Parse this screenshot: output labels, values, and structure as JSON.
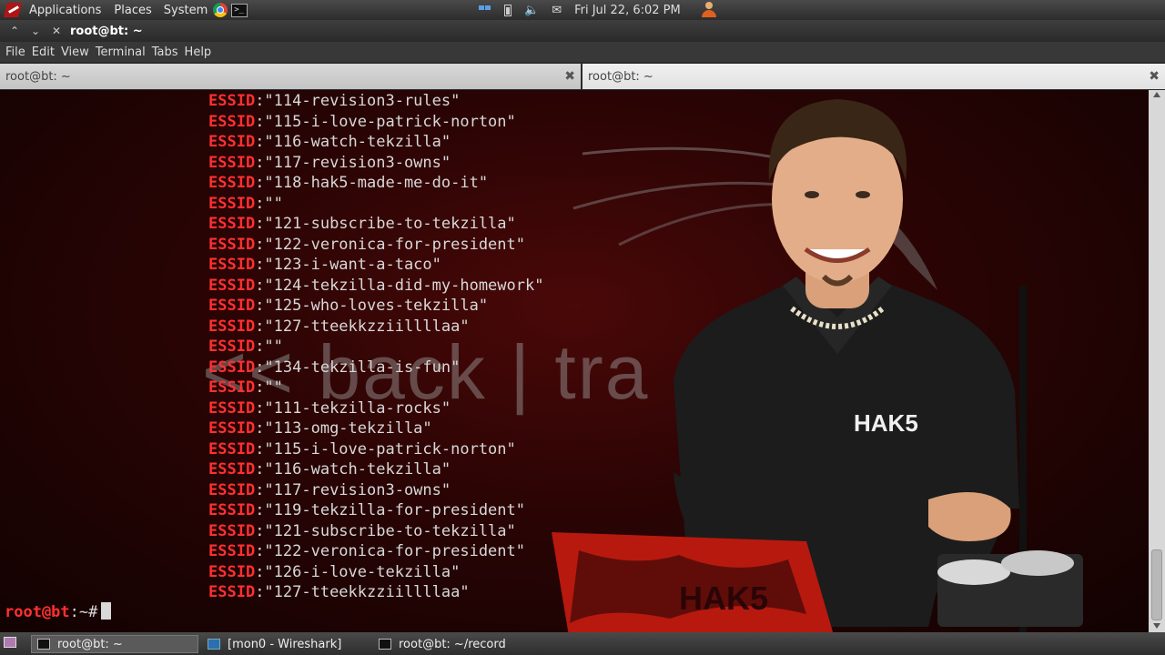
{
  "top_panel": {
    "menus": [
      "Applications",
      "Places",
      "System"
    ],
    "clock": "Fri Jul 22,  6:02 PM"
  },
  "window": {
    "title": "root@bt: ~",
    "menu": [
      "File",
      "Edit",
      "View",
      "Terminal",
      "Tabs",
      "Help"
    ],
    "tabs": [
      {
        "label": "root@bt: ~",
        "active": false
      },
      {
        "label": "root@bt: ~",
        "active": true
      }
    ]
  },
  "terminal": {
    "lines": [
      {
        "key": "ESSID",
        "value": ":\"114-revision3-rules\""
      },
      {
        "key": "ESSID",
        "value": ":\"115-i-love-patrick-norton\""
      },
      {
        "key": "ESSID",
        "value": ":\"116-watch-tekzilla\""
      },
      {
        "key": "ESSID",
        "value": ":\"117-revision3-owns\""
      },
      {
        "key": "ESSID",
        "value": ":\"118-hak5-made-me-do-it\""
      },
      {
        "key": "ESSID",
        "value": ":\"\""
      },
      {
        "key": "ESSID",
        "value": ":\"121-subscribe-to-tekzilla\""
      },
      {
        "key": "ESSID",
        "value": ":\"122-veronica-for-president\""
      },
      {
        "key": "ESSID",
        "value": ":\"123-i-want-a-taco\""
      },
      {
        "key": "ESSID",
        "value": ":\"124-tekzilla-did-my-homework\""
      },
      {
        "key": "ESSID",
        "value": ":\"125-who-loves-tekzilla\""
      },
      {
        "key": "ESSID",
        "value": ":\"127-tteekkzziillllaa\""
      },
      {
        "key": "ESSID",
        "value": ":\"\""
      },
      {
        "key": "ESSID",
        "value": ":\"134-tekzilla-is-fun\""
      },
      {
        "key": "ESSID",
        "value": ":\"\""
      },
      {
        "key": "ESSID",
        "value": ":\"111-tekzilla-rocks\""
      },
      {
        "key": "ESSID",
        "value": ":\"113-omg-tekzilla\""
      },
      {
        "key": "ESSID",
        "value": ":\"115-i-love-patrick-norton\""
      },
      {
        "key": "ESSID",
        "value": ":\"116-watch-tekzilla\""
      },
      {
        "key": "ESSID",
        "value": ":\"117-revision3-owns\""
      },
      {
        "key": "ESSID",
        "value": ":\"119-tekzilla-for-president\""
      },
      {
        "key": "ESSID",
        "value": ":\"121-subscribe-to-tekzilla\""
      },
      {
        "key": "ESSID",
        "value": ":\"122-veronica-for-president\""
      },
      {
        "key": "ESSID",
        "value": ":\"126-i-love-tekzilla\""
      },
      {
        "key": "ESSID",
        "value": ":\"127-tteekkzziillllaa\""
      }
    ],
    "prompt_user": "root@bt",
    "prompt_rest": ":~#",
    "watermark": "<< back | tra",
    "shirt_logo": "HAK5",
    "laptop_logo": "HAK5"
  },
  "taskbar": {
    "items": [
      {
        "label": "root@bt: ~",
        "active": true
      },
      {
        "label": "[mon0 - Wireshark]",
        "active": false
      },
      {
        "label": "root@bt: ~/record",
        "active": false
      }
    ]
  },
  "colors": {
    "essid_key": "#ff3030",
    "text": "#d8d8d8",
    "background": "#2a0404"
  }
}
